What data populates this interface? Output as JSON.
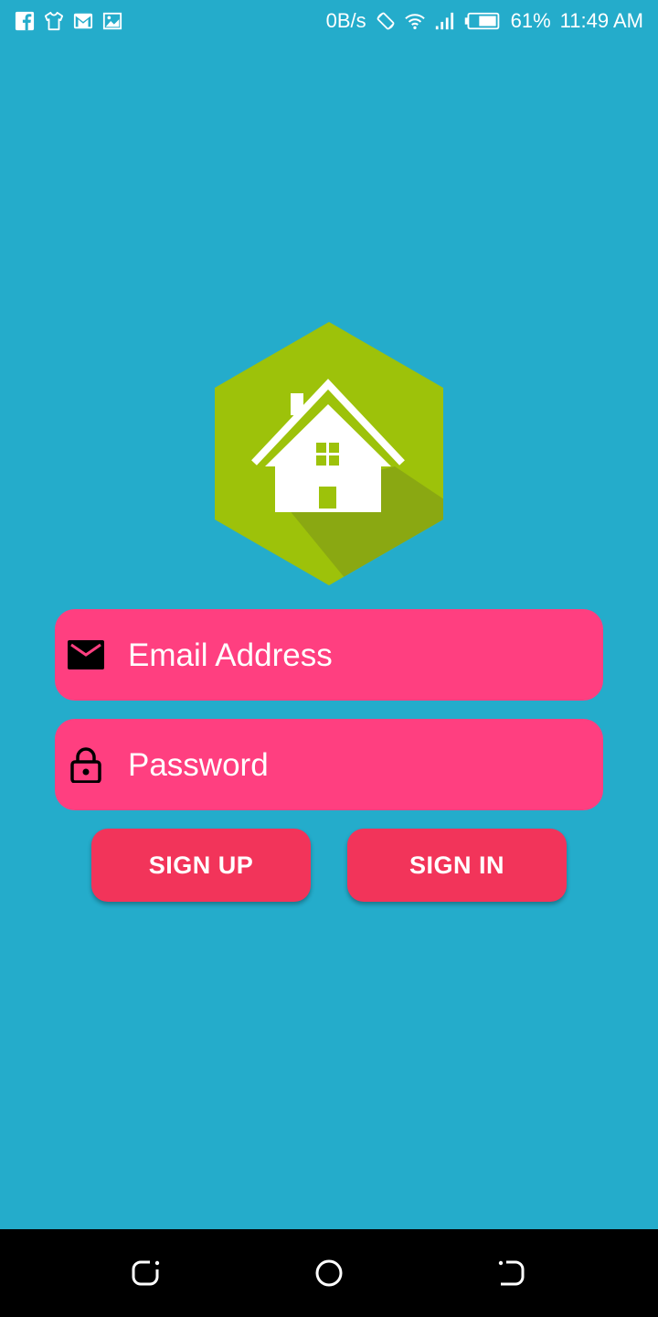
{
  "status_bar": {
    "left_icons": [
      "facebook-icon",
      "tshirt-icon",
      "gmail-icon",
      "image-icon"
    ],
    "net_speed": "0B/s",
    "battery": "61%",
    "time": "11:49 AM"
  },
  "logo": {
    "icon": "house-icon",
    "hex_color": "#9dc20a"
  },
  "form": {
    "email": {
      "placeholder": "Email Address",
      "value": "",
      "icon": "mail-icon"
    },
    "password": {
      "placeholder": "Password",
      "value": "",
      "icon": "lock-icon"
    }
  },
  "buttons": {
    "signup": "SIGN UP",
    "signin": "SIGN IN"
  },
  "colors": {
    "background": "#24accb",
    "field": "#ff3f80",
    "button": "#f2345a"
  },
  "nav": [
    "back-icon",
    "home-icon",
    "recent-apps-icon"
  ]
}
